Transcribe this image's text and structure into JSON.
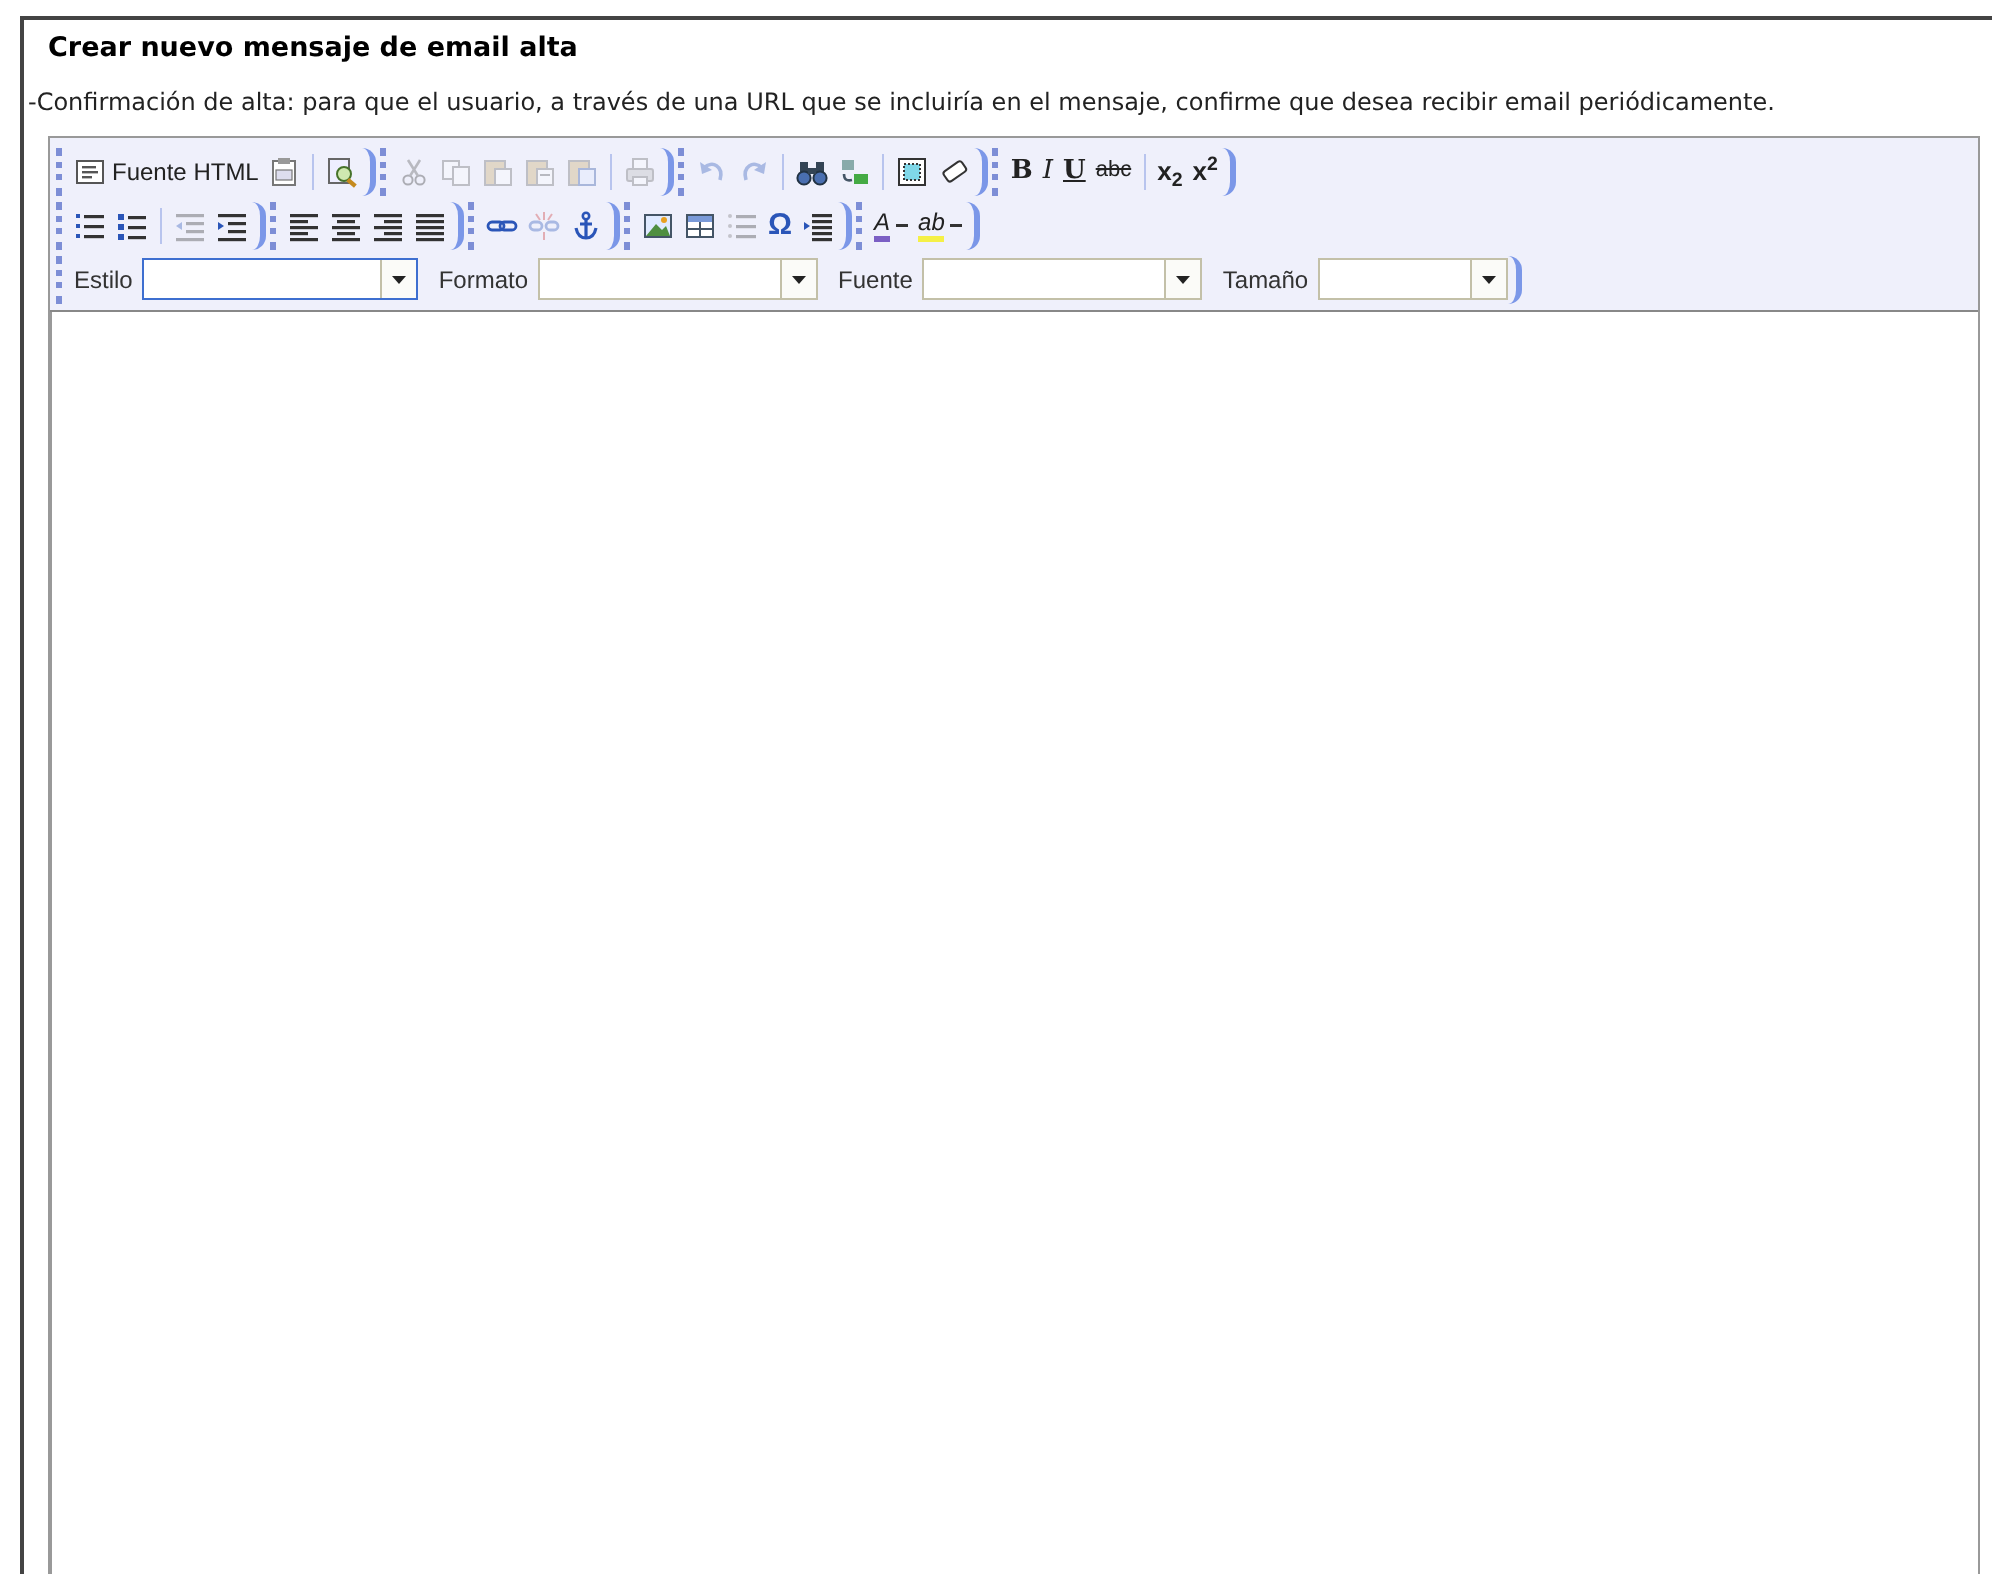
{
  "heading": "Crear nuevo mensaje de email alta",
  "description": "-Confirmación de alta: para que el usuario, a través de una URL que se incluiría en el mensaje, confirme que desea recibir email periódicamente.",
  "toolbar_rows": [
    [
      {
        "items": [
          {
            "kind": "source",
            "label": "Fuente HTML",
            "disabled": false
          },
          {
            "kind": "icon",
            "disabled": false
          },
          {
            "kind": "separator"
          },
          {
            "kind": "icon",
            "disabled": false
          }
        ]
      },
      {
        "items": [
          {
            "kind": "icon",
            "disabled": true
          },
          {
            "kind": "icon",
            "disabled": true
          },
          {
            "kind": "icon",
            "disabled": true
          },
          {
            "kind": "icon",
            "disabled": true
          },
          {
            "kind": "icon",
            "disabled": true
          },
          {
            "kind": "separator"
          },
          {
            "kind": "icon",
            "disabled": true
          }
        ]
      },
      {
        "items": [
          {
            "kind": "icon",
            "disabled": true
          },
          {
            "kind": "icon",
            "disabled": true
          },
          {
            "kind": "separator"
          },
          {
            "kind": "icon",
            "disabled": false
          },
          {
            "kind": "icon",
            "disabled": false
          },
          {
            "kind": "separator"
          },
          {
            "kind": "icon",
            "disabled": false
          },
          {
            "kind": "icon",
            "disabled": false
          }
        ]
      },
      {
        "items": [
          {
            "kind": "bold",
            "label": "B",
            "disabled": false
          },
          {
            "kind": "italic",
            "label": "I",
            "disabled": false
          },
          {
            "kind": "underline",
            "label": "U",
            "disabled": false
          },
          {
            "kind": "strike",
            "label": "abc",
            "disabled": false
          },
          {
            "kind": "separator"
          },
          {
            "kind": "script",
            "label": "x$_{2}$",
            "disabled": false
          },
          {
            "kind": "script",
            "label": "x$^{2}$",
            "disabled": false
          }
        ]
      }
    ],
    [
      {
        "items": [
          {
            "kind": "icon",
            "disabled": false
          },
          {
            "kind": "icon",
            "disabled": false
          },
          {
            "kind": "separator"
          },
          {
            "kind": "icon",
            "disabled": true
          },
          {
            "kind": "icon",
            "disabled": false
          }
        ]
      },
      {
        "items": [
          {
            "kind": "icon",
            "disabled": false
          },
          {
            "kind": "icon",
            "disabled": false
          },
          {
            "kind": "icon",
            "disabled": false
          },
          {
            "kind": "icon",
            "disabled": false
          }
        ]
      },
      {
        "items": [
          {
            "kind": "icon",
            "disabled": false
          },
          {
            "kind": "icon",
            "disabled": true
          },
          {
            "kind": "icon",
            "disabled": false
          }
        ]
      },
      {
        "items": [
          {
            "kind": "icon",
            "disabled": false
          },
          {
            "kind": "icon",
            "disabled": false
          },
          {
            "kind": "icon",
            "disabled": true
          },
          {
            "kind": "glyph",
            "label": "Ω",
            "disabled": false
          },
          {
            "kind": "icon",
            "disabled": false
          }
        ]
      },
      {
        "items": [
          {
            "kind": "color",
            "label": "A",
            "color": "#7b5fc4",
            "disabled": false
          },
          {
            "kind": "color",
            "label": "ab",
            "color": "#f5f046",
            "disabled": false
          }
        ]
      }
    ]
  ],
  "dropdowns": [
    {
      "label": "Estilo",
      "focused": true
    },
    {
      "label": "Formato",
      "focused": false
    },
    {
      "label": "Fuente",
      "focused": false
    },
    {
      "label": "Tamaño",
      "focused": false
    }
  ]
}
